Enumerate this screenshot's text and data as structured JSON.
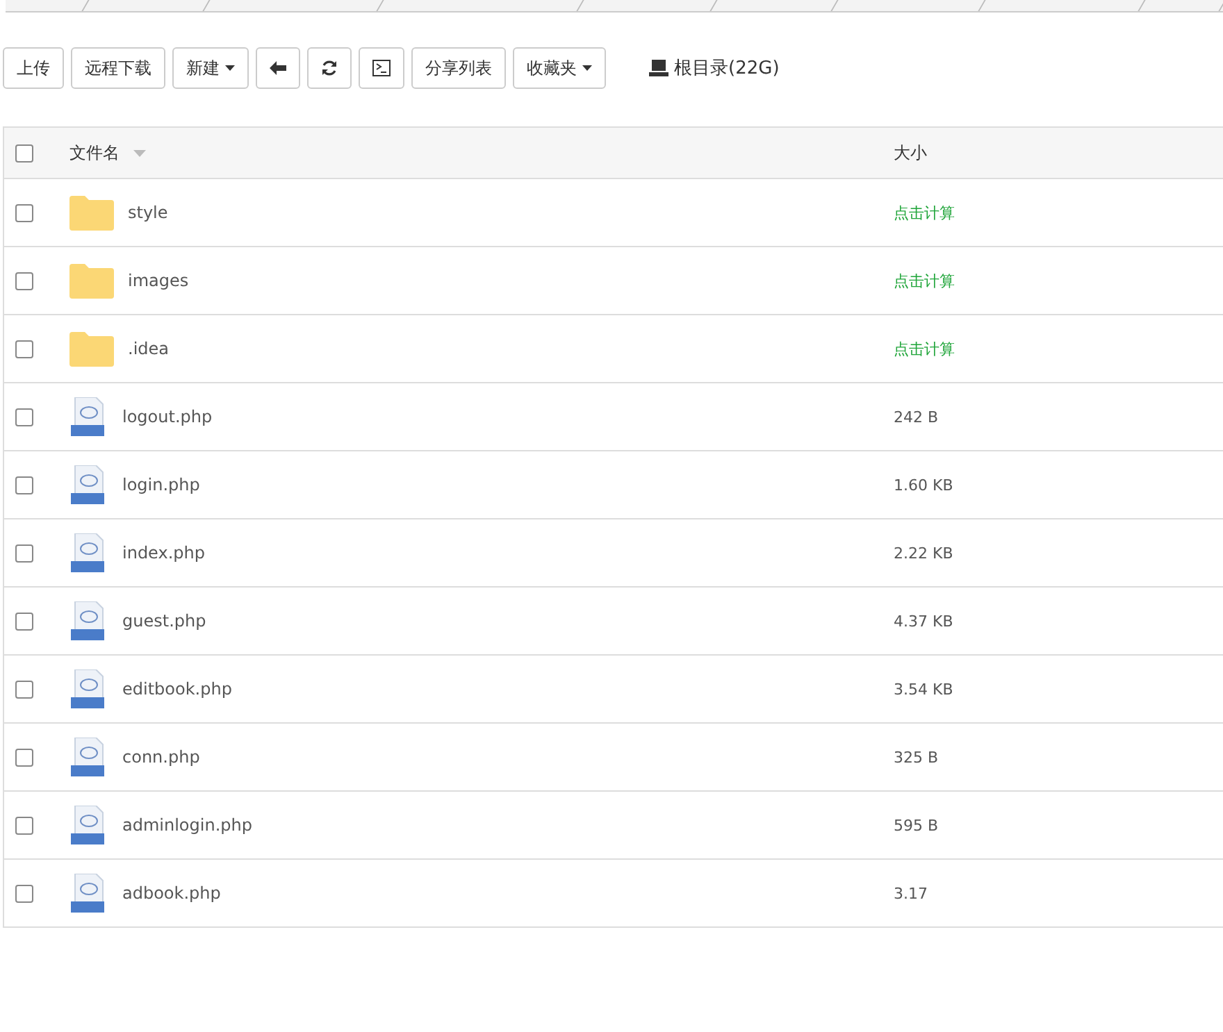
{
  "toolbar": {
    "buttons": [
      {
        "label": "上传",
        "kind": "text"
      },
      {
        "label": "远程下载",
        "kind": "text"
      },
      {
        "label": "新建",
        "kind": "dropdown"
      },
      {
        "kind": "back"
      },
      {
        "kind": "refresh"
      },
      {
        "kind": "terminal"
      },
      {
        "label": "分享列表",
        "kind": "text"
      },
      {
        "label": "收藏夹",
        "kind": "dropdown"
      }
    ],
    "disk": "根目录(22G)"
  },
  "table": {
    "all_checked": false,
    "columns": [
      {
        "label": "文件名"
      },
      {
        "label": "大小"
      }
    ],
    "rows": [
      {
        "name": "style",
        "kind": "folder",
        "size": "点击计算",
        "checked": false
      },
      {
        "name": "images",
        "kind": "folder",
        "size": "点击计算",
        "checked": false
      },
      {
        "name": ".idea",
        "kind": "folder",
        "size": "点击计算",
        "checked": false
      },
      {
        "name": "logout.php",
        "kind": "php",
        "size": "242 B",
        "checked": false
      },
      {
        "name": "login.php",
        "kind": "php",
        "size": "1.60 KB",
        "checked": false
      },
      {
        "name": "index.php",
        "kind": "php",
        "size": "2.22 KB",
        "checked": false
      },
      {
        "name": "guest.php",
        "kind": "php",
        "size": "4.37 KB",
        "checked": false
      },
      {
        "name": "editbook.php",
        "kind": "php",
        "size": "3.54 KB",
        "checked": false
      },
      {
        "name": "conn.php",
        "kind": "php",
        "size": "325 B",
        "checked": false
      },
      {
        "name": "adminlogin.php",
        "kind": "php",
        "size": "595 B",
        "checked": false
      },
      {
        "name": "adbook.php",
        "kind": "php",
        "size": "3.17",
        "checked": false
      }
    ]
  }
}
